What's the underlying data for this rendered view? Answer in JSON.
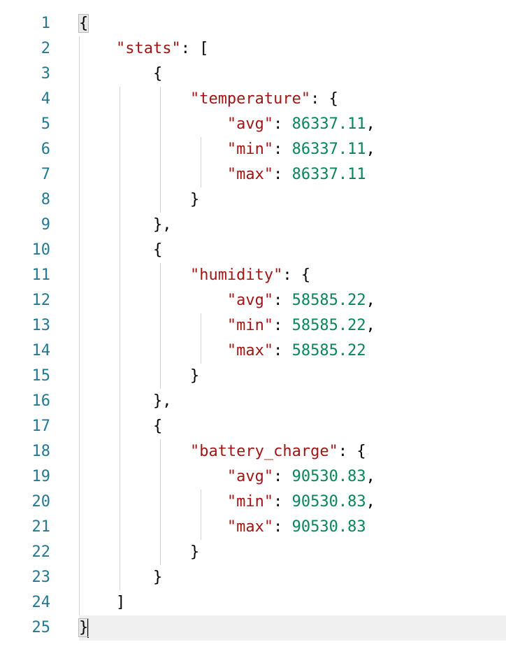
{
  "editor": {
    "line_numbers": [
      "1",
      "2",
      "3",
      "4",
      "5",
      "6",
      "7",
      "8",
      "9",
      "10",
      "11",
      "12",
      "13",
      "14",
      "15",
      "16",
      "17",
      "18",
      "19",
      "20",
      "21",
      "22",
      "23",
      "24",
      "25"
    ],
    "root_key": "\"stats\"",
    "entries": [
      {
        "key": "\"temperature\"",
        "avg_key": "\"avg\"",
        "avg": "86337.11",
        "min_key": "\"min\"",
        "min": "86337.11",
        "max_key": "\"max\"",
        "max": "86337.11"
      },
      {
        "key": "\"humidity\"",
        "avg_key": "\"avg\"",
        "avg": "58585.22",
        "min_key": "\"min\"",
        "min": "58585.22",
        "max_key": "\"max\"",
        "max": "58585.22"
      },
      {
        "key": "\"battery_charge\"",
        "avg_key": "\"avg\"",
        "avg": "90530.83",
        "min_key": "\"min\"",
        "min": "90530.83",
        "max_key": "\"max\"",
        "max": "90530.83"
      }
    ],
    "colors": {
      "line_number": "#237893",
      "string_key": "#a31515",
      "number": "#098658",
      "punctuation": "#000000",
      "current_line": "#f0f0f0"
    }
  }
}
